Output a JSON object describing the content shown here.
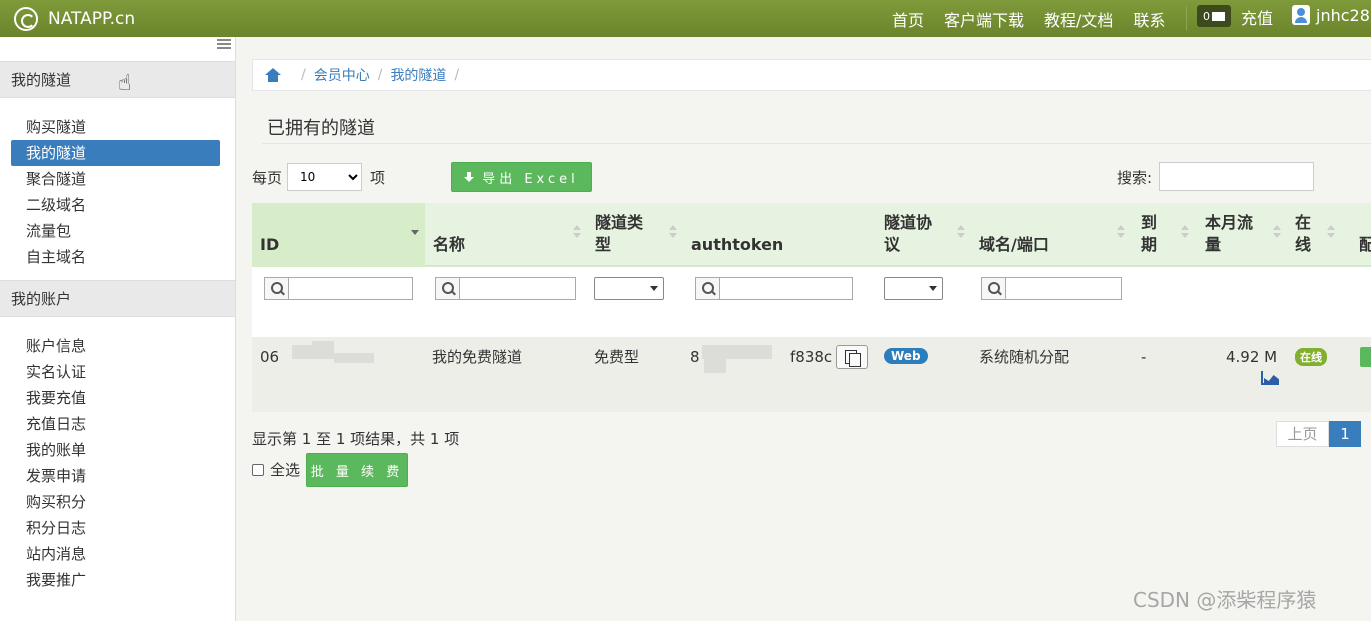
{
  "navbar": {
    "brand": "NATAPP.cn",
    "links": [
      "首页",
      "客户端下载",
      "教程/文档",
      "联系"
    ],
    "message_count": "0",
    "recharge": "充值",
    "username": "jnhc28"
  },
  "sidebar": {
    "tunnels_header": "我的隧道",
    "tunnel_items": [
      "购买隧道",
      "我的隧道",
      "聚合隧道",
      "二级域名",
      "流量包",
      "自主域名"
    ],
    "account_header": "我的账户",
    "account_items": [
      "账户信息",
      "实名认证",
      "我要充值",
      "充值日志",
      "我的账单",
      "发票申请",
      "购买积分",
      "积分日志",
      "站内消息",
      "我要推广"
    ]
  },
  "breadcrumb": [
    "会员中心",
    "我的隧道"
  ],
  "page_title": "已拥有的隧道",
  "toolbar": {
    "per_page_label": "每页",
    "per_page_value": "10",
    "per_page_unit": "项",
    "export_label": "导出 Excel",
    "search_label": "搜索:"
  },
  "table": {
    "headers": {
      "id": "ID",
      "name": "名称",
      "type": "隧道类型",
      "authtoken": "authtoken",
      "protocol": "隧道协议",
      "domain": "域名/端口",
      "expire": "到期",
      "traffic": "本月流量",
      "online": "在线",
      "config": "配"
    },
    "row": {
      "id": "06",
      "name": "我的免费隧道",
      "type": "免费型",
      "authtoken_start": "8",
      "authtoken_end": "f838c",
      "protocol": "Web",
      "domain": "系统随机分配",
      "expire": "-",
      "traffic": "4.92 M",
      "online": "在线"
    }
  },
  "footer": {
    "info": "显示第 1 至 1 项结果，共 1 项",
    "prev": "上页",
    "current_page": "1",
    "select_all": "全选",
    "renew": "批 量 续 费"
  },
  "watermark": "CSDN @添柴程序猿",
  "colors": {
    "navbar": "#6b842c",
    "active": "#3a7dbd",
    "success": "#5cb85c",
    "table_header": "#e6f3e0"
  }
}
